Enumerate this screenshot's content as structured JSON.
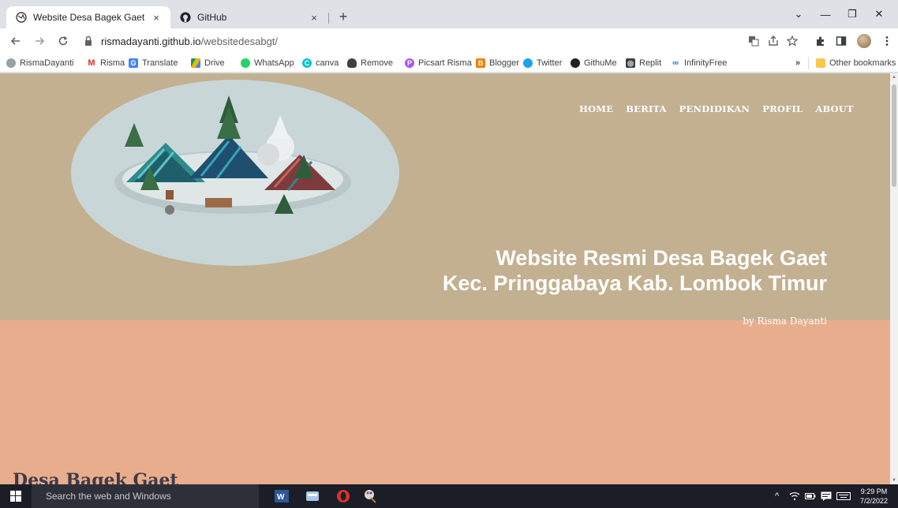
{
  "browser": {
    "tabs": [
      {
        "title": "Website Desa Bagek Gaet",
        "close": "×",
        "active": true
      },
      {
        "title": "GitHub",
        "close": "×",
        "active": false
      }
    ],
    "new_tab": "+",
    "window_controls": {
      "dropdown": "⌄",
      "minimize": "—",
      "restore": "❐",
      "close": "✕"
    },
    "url_host": "rismadayanti.github.io",
    "url_path": "/websitedesabgt/",
    "bookmarks": [
      {
        "label": "RismaDayanti",
        "icon": "globe-icon"
      },
      {
        "label": "Risma",
        "icon": "gmail-icon"
      },
      {
        "label": "Translate",
        "icon": "translate-icon"
      },
      {
        "label": "Drive",
        "icon": "drive-icon"
      },
      {
        "label": "WhatsApp",
        "icon": "whatsapp-icon"
      },
      {
        "label": "canva",
        "icon": "canva-icon"
      },
      {
        "label": "Remove",
        "icon": "remove-icon"
      },
      {
        "label": "Picsart Risma",
        "icon": "picsart-icon"
      },
      {
        "label": "Blogger",
        "icon": "blogger-icon"
      },
      {
        "label": "Twitter",
        "icon": "twitter-icon"
      },
      {
        "label": "GithuMe",
        "icon": "github-icon"
      },
      {
        "label": "Replit",
        "icon": "replit-icon"
      },
      {
        "label": "InfinityFree",
        "icon": "infinity-icon"
      }
    ],
    "bookmarks_overflow": "»",
    "other_bookmarks": "Other bookmarks"
  },
  "site": {
    "nav": [
      "HOME",
      "BERITA",
      "PENDIDIKAN",
      "PROFIL",
      "ABOUT"
    ],
    "headline_line1": "Website Resmi Desa Bagek Gaet",
    "headline_line2": "Kec. Pringgabaya Kab. Lombok Timur",
    "byline": "by Risma Dayanti",
    "section_title": "Desa Bagek Gaet"
  },
  "taskbar": {
    "search_placeholder": "Search the web and Windows",
    "time": "9:29 PM",
    "date": "7/2/2022",
    "tray_chevron": "^"
  },
  "colors": {
    "hero_bg": "#c2b091",
    "page_bg": "#e8ad8c",
    "ellipse": "#c8d6d8"
  }
}
